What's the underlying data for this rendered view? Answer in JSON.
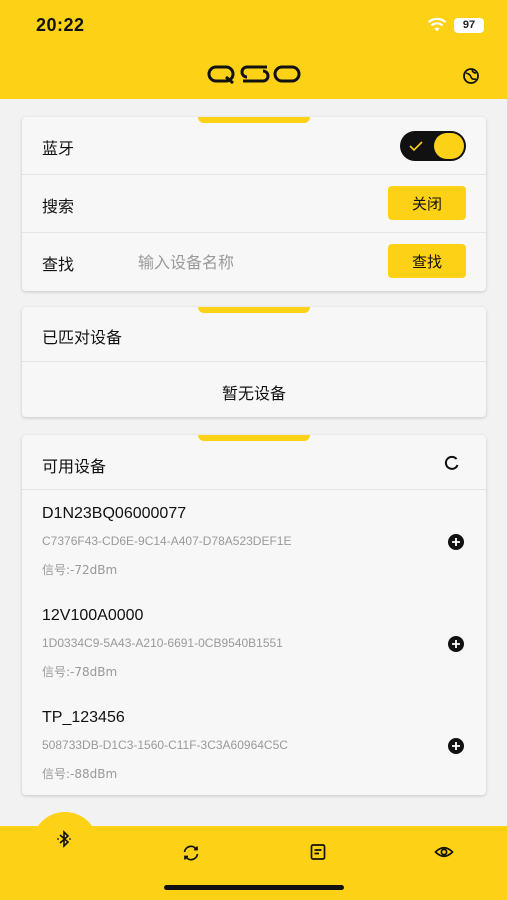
{
  "status_bar": {
    "time": "20:22",
    "battery": "97",
    "wifi_icon": "wifi-icon"
  },
  "header": {
    "logo": "QSO",
    "right_icon": "globe-icon"
  },
  "settings_card": {
    "bluetooth_label": "蓝牙",
    "bluetooth_on": true,
    "search_label": "搜索",
    "search_button": "关闭",
    "find_label": "查找",
    "find_placeholder": "输入设备名称",
    "find_value": "",
    "find_button": "查找"
  },
  "paired_card": {
    "title": "已匹对设备",
    "empty_text": "暂无设备"
  },
  "available_card": {
    "title": "可用设备",
    "refresh_icon": "refresh-icon",
    "devices": [
      {
        "name": "D1N23BQ06000077",
        "uuid": "C7376F43-CD6E-9C14-A407-D78A523DEF1E",
        "signal": "信号:-72dBm"
      },
      {
        "name": "12V100A0000",
        "uuid": "1D0334C9-5A43-A210-6691-0CB9540B1551",
        "signal": "信号:-78dBm"
      },
      {
        "name": "TP_123456",
        "uuid": "508733DB-D1C3-1560-C11F-3C3A60964C5C",
        "signal": "信号:-88dBm"
      }
    ]
  },
  "tabbar": {
    "tabs": [
      "bluetooth-icon",
      "sync-icon",
      "document-icon",
      "eye-icon"
    ],
    "active_tab": "bluetooth-icon"
  },
  "colors": {
    "accent": "#fcd116",
    "background": "#f2f2f2",
    "card": "#f7f7f7"
  }
}
